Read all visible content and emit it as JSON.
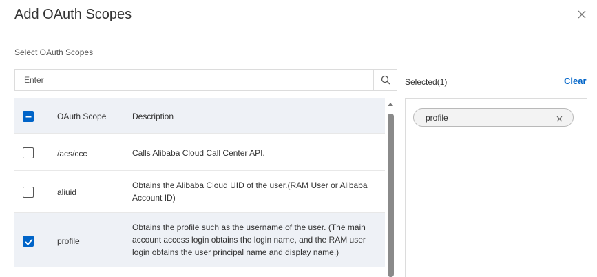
{
  "dialog": {
    "title": "Add OAuth Scopes",
    "section_label": "Select OAuth Scopes",
    "search": {
      "placeholder": "Enter",
      "value": ""
    }
  },
  "table": {
    "header_checkbox_state": "indeterminate",
    "columns": [
      "OAuth Scope",
      "Description"
    ],
    "rows": [
      {
        "scope": "/acs/ccc",
        "description": "Calls Alibaba Cloud Call Center API.",
        "checked": false
      },
      {
        "scope": "aliuid",
        "description": "Obtains the Alibaba Cloud UID of the user.(RAM User or Alibaba Account ID)",
        "checked": false
      },
      {
        "scope": "profile",
        "description": "Obtains the profile such as the username of the user. (The main account access login obtains the login name, and the RAM user login obtains the user principal name and display name.)",
        "checked": true
      }
    ]
  },
  "selected": {
    "label": "Selected(1)",
    "clear_label": "Clear",
    "items": [
      {
        "label": "profile"
      }
    ]
  },
  "colors": {
    "accent": "#0064c8",
    "header_bg": "#eef1f6",
    "border": "#dcdcdc"
  },
  "icons": {
    "close": "close-icon",
    "search": "search-icon",
    "checkbox_checked": "check-icon",
    "checkbox_indeterminate": "minus-icon",
    "tag_remove": "close-icon"
  }
}
